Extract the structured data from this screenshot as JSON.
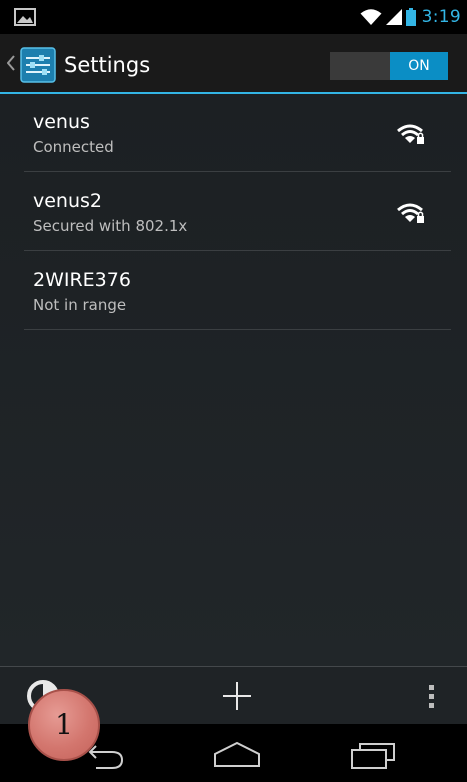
{
  "status_bar": {
    "time": "3:19",
    "icons": [
      "image-notification-icon",
      "wifi-icon",
      "cell-signal-icon",
      "battery-icon"
    ]
  },
  "action_bar": {
    "title": "Settings",
    "toggle_label": "ON",
    "icons": [
      "up-caret-icon",
      "settings-app-icon"
    ]
  },
  "networks": [
    {
      "name": "venus",
      "status": "Connected",
      "signal_icon": "wifi-lock-icon"
    },
    {
      "name": "venus2",
      "status": "Secured with 802.1x",
      "signal_icon": "wifi-lock-icon"
    },
    {
      "name": "2WIRE376",
      "status": "Not in range",
      "signal_icon": null
    }
  ],
  "bottom_bar": {
    "icons": [
      "scan-icon",
      "add-network-icon",
      "overflow-menu-icon"
    ]
  },
  "nav_bar": {
    "icons": [
      "back-icon",
      "home-icon",
      "recents-icon"
    ]
  },
  "annotation": {
    "marker_label": "1"
  },
  "colors": {
    "accent": "#33b5e5",
    "toggle_on": "#0b8ec5",
    "background": "#1c2023",
    "marker": "#d3766e"
  }
}
